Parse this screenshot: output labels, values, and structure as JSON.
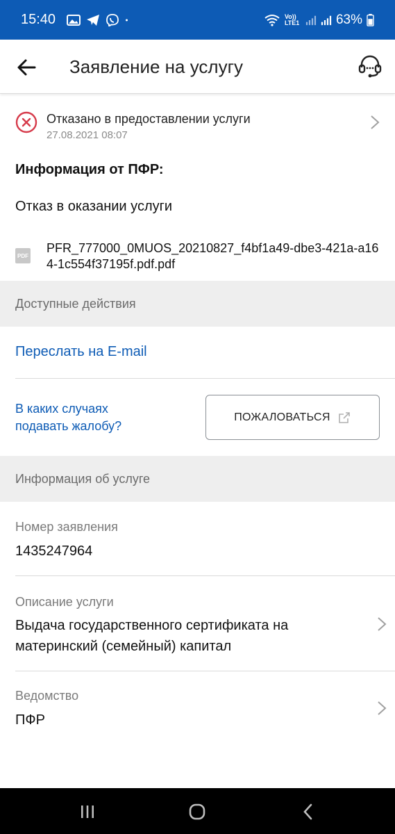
{
  "status_bar": {
    "time": "15:40",
    "battery": "63%",
    "left_icons": [
      "gallery-icon",
      "telegram-icon",
      "viber-icon",
      "dot-icon"
    ],
    "right_icons": [
      "wifi-icon",
      "volte-icon",
      "signal-icon",
      "signal-icon",
      "battery-icon"
    ],
    "volte_label": "Vo)) LTE1"
  },
  "app_bar": {
    "title": "Заявление на услугу"
  },
  "status": {
    "text": "Отказано в предоставлении услуги",
    "date": "27.08.2021 08:07",
    "color": "#d63a4a"
  },
  "info": {
    "heading": "Информация от ПФР:",
    "text": "Отказ в оказании услуги"
  },
  "file": {
    "icon_label": "PDF",
    "name": "PFR_777000_0MUOS_20210827_f4bf1a49-dbe3-421a-a164-1c554f37195f.pdf.pdf"
  },
  "actions": {
    "section_label": "Доступные действия",
    "email_link": "Переслать на E-mail",
    "complain_question_line1": "В каких случаях",
    "complain_question_line2": "подавать жалобу?",
    "complain_button": "ПОЖАЛОВАТЬСЯ"
  },
  "service_info": {
    "section_label": "Информация об услуге",
    "fields": [
      {
        "label": "Номер заявления",
        "value": "1435247964"
      },
      {
        "label": "Описание услуги",
        "value_line1": "Выдача государственного сертификата на",
        "value_line2": "материнский (семейный) капитал"
      },
      {
        "label": "Ведомство",
        "value": "ПФР"
      }
    ]
  },
  "colors": {
    "brand_blue": "#0d5bb5",
    "link_blue": "#0d5bb5",
    "error_red": "#d63a4a",
    "section_gray": "#eeeeee"
  }
}
